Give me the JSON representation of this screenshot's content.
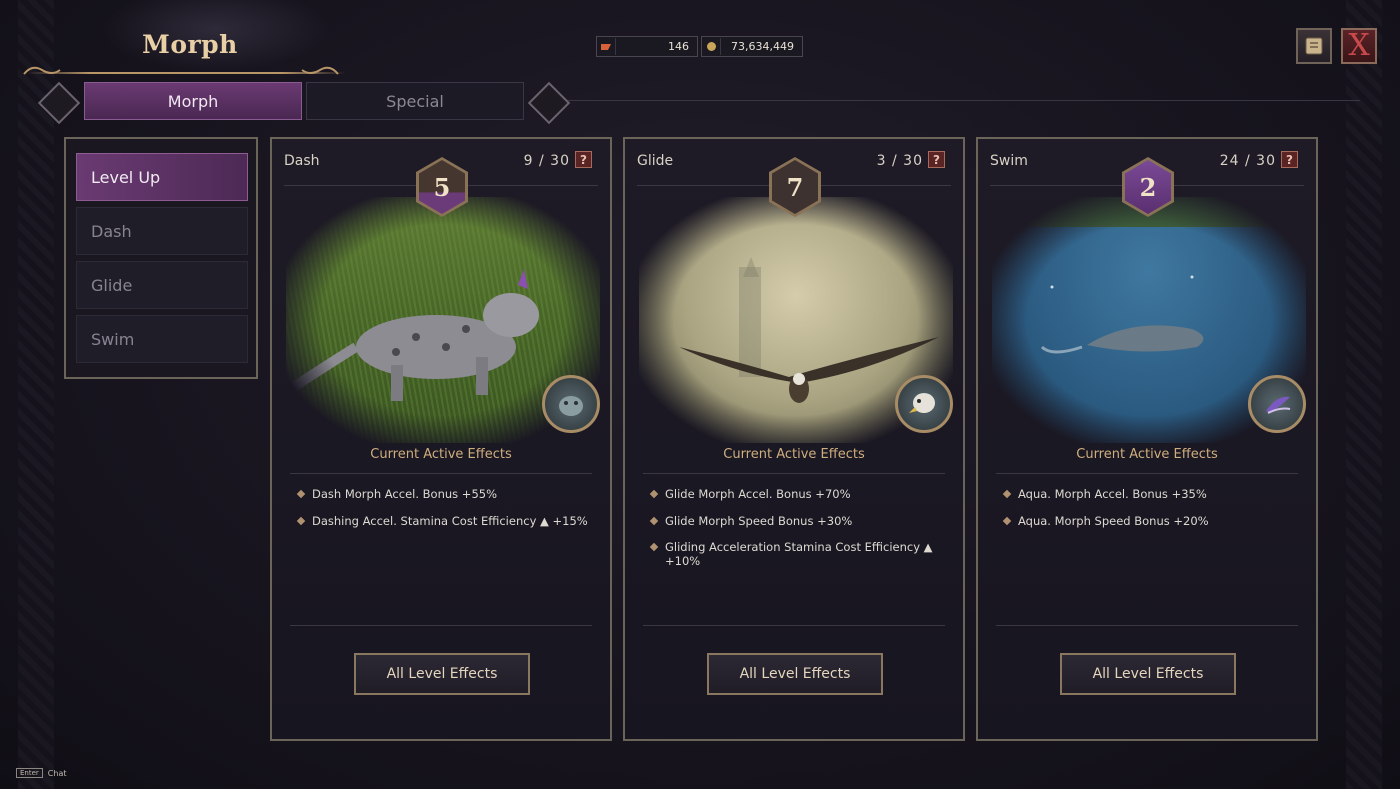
{
  "window": {
    "title": "Morph"
  },
  "currency": [
    {
      "icon": "scroll-ticket-icon",
      "value": "146"
    },
    {
      "icon": "coin-icon",
      "value": "73,634,449"
    }
  ],
  "tabs": [
    {
      "label": "Morph",
      "active": true
    },
    {
      "label": "Special",
      "active": false
    }
  ],
  "menu": {
    "items": [
      {
        "label": "Level Up",
        "active": true
      },
      {
        "label": "Dash",
        "active": false
      },
      {
        "label": "Glide",
        "active": false
      },
      {
        "label": "Swim",
        "active": false
      }
    ]
  },
  "cards": [
    {
      "name": "Dash",
      "count": "9 / 30",
      "level": "5",
      "section_title": "Current Active Effects",
      "effects": [
        "Dash Morph Accel. Bonus +55%",
        "Dashing Accel. Stamina Cost Efficiency ▲ +15%"
      ],
      "button": "All Level Effects"
    },
    {
      "name": "Glide",
      "count": "3 / 30",
      "level": "7",
      "section_title": "Current Active Effects",
      "effects": [
        "Glide Morph Accel. Bonus +70%",
        "Glide Morph Speed Bonus  +30%",
        "Gliding Acceleration Stamina Cost Efficiency ▲ +10%"
      ],
      "button": "All Level Effects"
    },
    {
      "name": "Swim",
      "count": "24 / 30",
      "level": "2",
      "section_title": "Current Active Effects",
      "effects": [
        "Aqua. Morph Accel. Bonus +35%",
        "Aqua. Morph Speed Bonus +20%"
      ],
      "button": "All Level Effects"
    }
  ],
  "help_label": "?",
  "close_label": "X",
  "footer": {
    "key": "Enter",
    "label": "Chat"
  },
  "colors": {
    "accent_purple": "#6a3a72",
    "gold": "#cfae7e",
    "close_red": "#c84a4a"
  }
}
